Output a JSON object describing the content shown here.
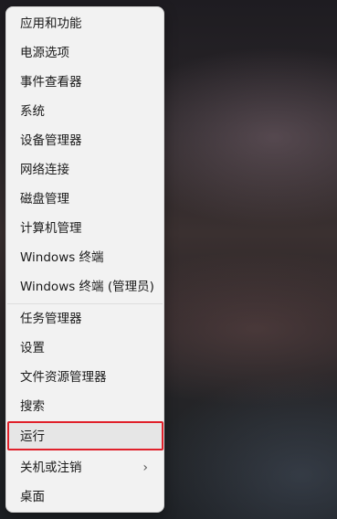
{
  "menu": {
    "items": [
      {
        "label": "应用和功能"
      },
      {
        "label": "电源选项"
      },
      {
        "label": "事件查看器"
      },
      {
        "label": "系统"
      },
      {
        "label": "设备管理器"
      },
      {
        "label": "网络连接"
      },
      {
        "label": "磁盘管理"
      },
      {
        "label": "计算机管理"
      },
      {
        "label": "Windows 终端"
      },
      {
        "label": "Windows 终端 (管理员)"
      },
      {
        "label": "任务管理器"
      },
      {
        "label": "设置"
      },
      {
        "label": "文件资源管理器"
      },
      {
        "label": "搜索"
      },
      {
        "label": "运行"
      },
      {
        "label": "关机或注销",
        "submenu_icon": "chevron-right-icon"
      },
      {
        "label": "桌面"
      }
    ],
    "highlighted_item": "运行",
    "highlight_color": "#e0202a"
  }
}
